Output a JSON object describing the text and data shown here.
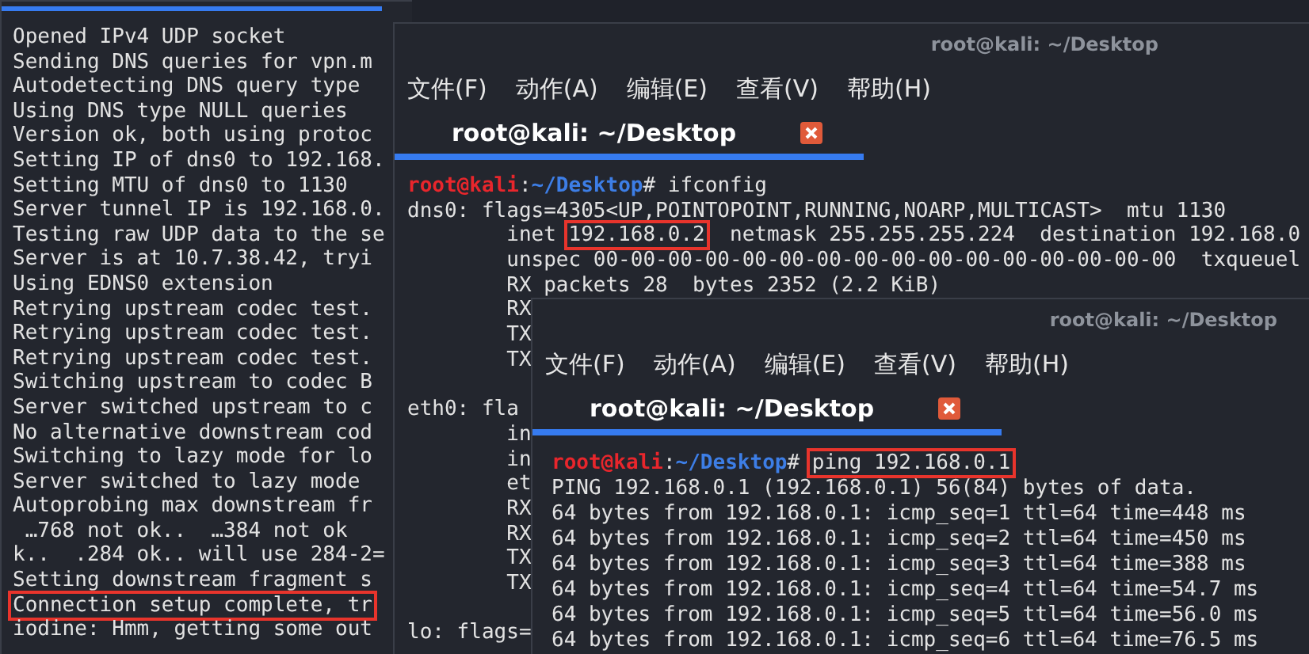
{
  "windows": [
    {
      "lines": [
        {
          "kind": "text",
          "text": "Opened IPv4 UDP socket",
          "highlighted": false
        },
        {
          "kind": "text",
          "text": "Sending DNS queries for vpn.m",
          "highlighted": false
        },
        {
          "kind": "text",
          "text": "Autodetecting DNS query type",
          "highlighted": false
        },
        {
          "kind": "text",
          "text": "Using DNS type NULL queries",
          "highlighted": false
        },
        {
          "kind": "text",
          "text": "Version ok, both using protoc",
          "highlighted": false
        },
        {
          "kind": "text",
          "text": "Setting IP of dns0 to 192.168.",
          "highlighted": false
        },
        {
          "kind": "text",
          "text": "Setting MTU of dns0 to 1130",
          "highlighted": false
        },
        {
          "kind": "text",
          "text": "Server tunnel IP is 192.168.0.",
          "highlighted": false
        },
        {
          "kind": "text",
          "text": "Testing raw UDP data to the se",
          "highlighted": false
        },
        {
          "kind": "text",
          "text": "Server is at 10.7.38.42, tryi",
          "highlighted": false
        },
        {
          "kind": "text",
          "text": "Using EDNS0 extension",
          "highlighted": false
        },
        {
          "kind": "text",
          "text": "Retrying upstream codec test.",
          "highlighted": false
        },
        {
          "kind": "text",
          "text": "Retrying upstream codec test.",
          "highlighted": false
        },
        {
          "kind": "text",
          "text": "Retrying upstream codec test.",
          "highlighted": false
        },
        {
          "kind": "text",
          "text": "Switching upstream to codec B",
          "highlighted": false
        },
        {
          "kind": "text",
          "text": "Server switched upstream to c",
          "highlighted": false
        },
        {
          "kind": "text",
          "text": "No alternative downstream cod",
          "highlighted": false
        },
        {
          "kind": "text",
          "text": "Switching to lazy mode for lo",
          "highlighted": false
        },
        {
          "kind": "text",
          "text": "Server switched to lazy mode",
          "highlighted": false
        },
        {
          "kind": "text",
          "text": "Autoprobing max downstream fr",
          "highlighted": false
        },
        {
          "kind": "text",
          "text": " …768 not ok..  …384 not ok",
          "highlighted": false
        },
        {
          "kind": "text",
          "text": "k..  .284 ok.. will use 284-2=",
          "highlighted": false
        },
        {
          "kind": "text",
          "text": "Setting downstream fragment s",
          "highlighted": false
        },
        {
          "kind": "text",
          "text": "Connection setup complete, tr",
          "highlighted": true
        },
        {
          "kind": "text",
          "text": "iodine: Hmm, getting some out",
          "highlighted": false
        }
      ]
    },
    {
      "title": "root@kali: ~/Desktop",
      "menu": [
        "文件(F)",
        "动作(A)",
        "编辑(E)",
        "查看(V)",
        "帮助(H)"
      ],
      "tabs": [
        {
          "label": "root@kali: ~/Desktop",
          "selected": true
        }
      ],
      "lines": [
        {
          "kind": "command",
          "user": "root@kali",
          "sep": ":",
          "path": "~/Desktop",
          "mark": "#",
          "command": "ifconfig",
          "highlighted": false
        },
        {
          "kind": "text",
          "text": "dns0: flags=4305<UP,POINTOPOINT,RUNNING,NOARP,MULTICAST>  mtu 1130",
          "highlighted": false
        },
        {
          "kind": "parts",
          "parts": [
            {
              "text": "        inet ",
              "highlighted": false
            },
            {
              "text": "192.168.0.2",
              "highlighted": true
            },
            {
              "text": "  netmask 255.255.255.224  destination 192.168.0",
              "highlighted": false
            }
          ]
        },
        {
          "kind": "text",
          "text": "        unspec 00-00-00-00-00-00-00-00-00-00-00-00-00-00-00-00  txqueuel",
          "highlighted": false
        },
        {
          "kind": "text",
          "text": "        RX packets 28  bytes 2352 (2.2 KiB)",
          "highlighted": false
        },
        {
          "kind": "text",
          "text": "        RX",
          "highlighted": false
        },
        {
          "kind": "text",
          "text": "        TX",
          "highlighted": false
        },
        {
          "kind": "text",
          "text": "        TX",
          "highlighted": false
        },
        {
          "kind": "blank"
        },
        {
          "kind": "text",
          "text": "eth0: fla",
          "highlighted": false
        },
        {
          "kind": "text",
          "text": "        in",
          "highlighted": false
        },
        {
          "kind": "text",
          "text": "        in",
          "highlighted": false
        },
        {
          "kind": "text",
          "text": "        et",
          "highlighted": false
        },
        {
          "kind": "text",
          "text": "        RX",
          "highlighted": false
        },
        {
          "kind": "text",
          "text": "        RX",
          "highlighted": false
        },
        {
          "kind": "text",
          "text": "        TX",
          "highlighted": false
        },
        {
          "kind": "text",
          "text": "        TX",
          "highlighted": false
        },
        {
          "kind": "blank"
        },
        {
          "kind": "text",
          "text": "lo: flags=",
          "highlighted": false
        }
      ]
    },
    {
      "title": "root@kali: ~/Desktop",
      "menu": [
        "文件(F)",
        "动作(A)",
        "编辑(E)",
        "查看(V)",
        "帮助(H)"
      ],
      "tabs": [
        {
          "label": "root@kali: ~/Desktop",
          "selected": true
        }
      ],
      "lines": [
        {
          "kind": "command",
          "user": "root@kali",
          "sep": ":",
          "path": "~/Desktop",
          "mark": "#",
          "command": "ping 192.168.0.1",
          "highlighted": true
        },
        {
          "kind": "text",
          "text": "PING 192.168.0.1 (192.168.0.1) 56(84) bytes of data.",
          "highlighted": false
        },
        {
          "kind": "text",
          "text": "64 bytes from 192.168.0.1: icmp_seq=1 ttl=64 time=448 ms",
          "highlighted": false
        },
        {
          "kind": "text",
          "text": "64 bytes from 192.168.0.1: icmp_seq=2 ttl=64 time=450 ms",
          "highlighted": false
        },
        {
          "kind": "text",
          "text": "64 bytes from 192.168.0.1: icmp_seq=3 ttl=64 time=388 ms",
          "highlighted": false
        },
        {
          "kind": "text",
          "text": "64 bytes from 192.168.0.1: icmp_seq=4 ttl=64 time=54.7 ms",
          "highlighted": false
        },
        {
          "kind": "text",
          "text": "64 bytes from 192.168.0.1: icmp_seq=5 ttl=64 time=56.0 ms",
          "highlighted": false
        },
        {
          "kind": "text",
          "text": "64 bytes from 192.168.0.1: icmp_seq=6 ttl=64 time=76.5 ms",
          "highlighted": false
        }
      ]
    }
  ]
}
